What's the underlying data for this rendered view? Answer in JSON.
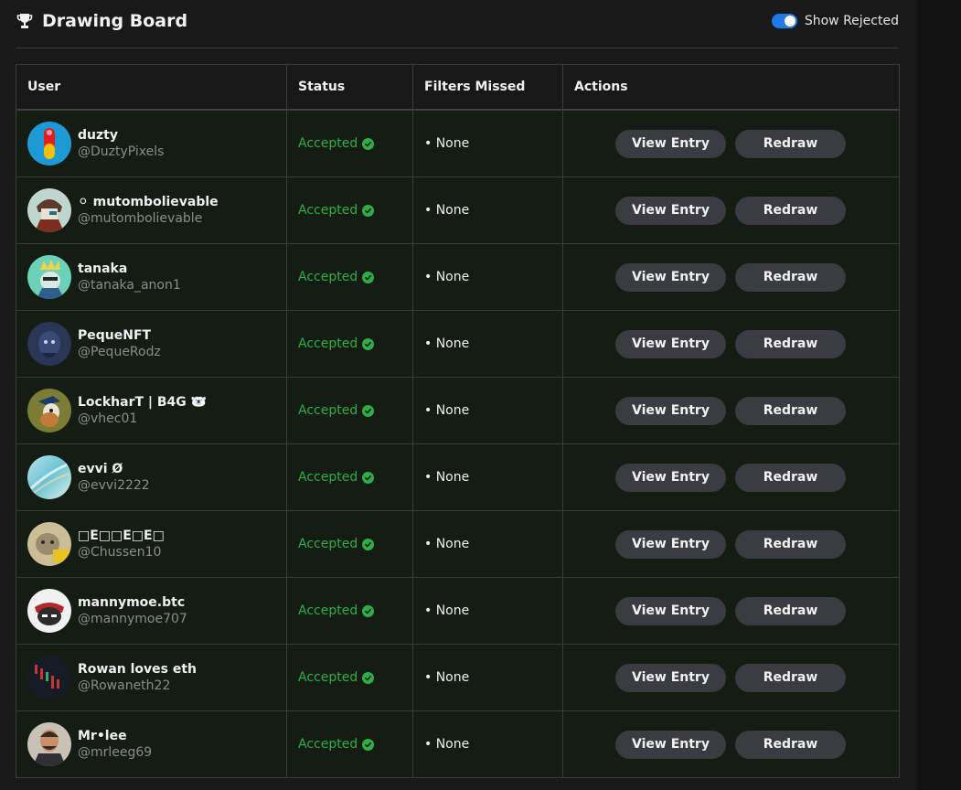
{
  "header": {
    "title": "Drawing Board",
    "title_icon": "trophy-icon",
    "toggle_label": "Show Rejected",
    "toggle_on": true,
    "accent_color": "#1f7ae8"
  },
  "table": {
    "columns": [
      "User",
      "Status",
      "Filters Missed",
      "Actions"
    ],
    "status_color": "#2fae48",
    "rows": [
      {
        "name": "duzty",
        "handle": "@DuztyPixels",
        "status": "Accepted",
        "filters_missed": "• None",
        "view_label": "View Entry",
        "redraw_label": "Redraw",
        "avatar": "avatar-red-pill"
      },
      {
        "name": "⚪ mutombolievable",
        "handle": "@mutombolievable",
        "status": "Accepted",
        "filters_missed": "• None",
        "view_label": "View Entry",
        "redraw_label": "Redraw",
        "avatar": "avatar-character-teal"
      },
      {
        "name": "tanaka",
        "handle": "@tanaka_anon1",
        "status": "Accepted",
        "filters_missed": "• None",
        "view_label": "View Entry",
        "redraw_label": "Redraw",
        "avatar": "avatar-crowned-character"
      },
      {
        "name": "PequeNFT",
        "handle": "@PequeRodz",
        "status": "Accepted",
        "filters_missed": "• None",
        "view_label": "View Entry",
        "redraw_label": "Redraw",
        "avatar": "avatar-dark-blue-character"
      },
      {
        "name": "LockharT | B4G 🐻‍❄️",
        "handle": "@vhec01",
        "status": "Accepted",
        "filters_missed": "• None",
        "view_label": "View Entry",
        "redraw_label": "Redraw",
        "avatar": "avatar-dog-captain"
      },
      {
        "name": "evvi Ø",
        "handle": "@evvi2222",
        "status": "Accepted",
        "filters_missed": "• None",
        "view_label": "View Entry",
        "redraw_label": "Redraw",
        "avatar": "avatar-pastel-swirl"
      },
      {
        "name": "□E□□E□E□",
        "handle": "@Chussen10",
        "status": "Accepted",
        "filters_missed": "• None",
        "view_label": "View Entry",
        "redraw_label": "Redraw",
        "avatar": "avatar-cat-photo"
      },
      {
        "name": "mannymoe.btc",
        "handle": "@mannymoe707",
        "status": "Accepted",
        "filters_missed": "• None",
        "view_label": "View Entry",
        "redraw_label": "Redraw",
        "avatar": "avatar-bandana-character"
      },
      {
        "name": "Rowan loves eth",
        "handle": "@Rowaneth22",
        "status": "Accepted",
        "filters_missed": "• None",
        "view_label": "View Entry",
        "redraw_label": "Redraw",
        "avatar": "avatar-dark-candles"
      },
      {
        "name": "Mr•lee",
        "handle": "@mrleeg69",
        "status": "Accepted",
        "filters_missed": "• None",
        "view_label": "View Entry",
        "redraw_label": "Redraw",
        "avatar": "avatar-man-portrait"
      }
    ]
  }
}
